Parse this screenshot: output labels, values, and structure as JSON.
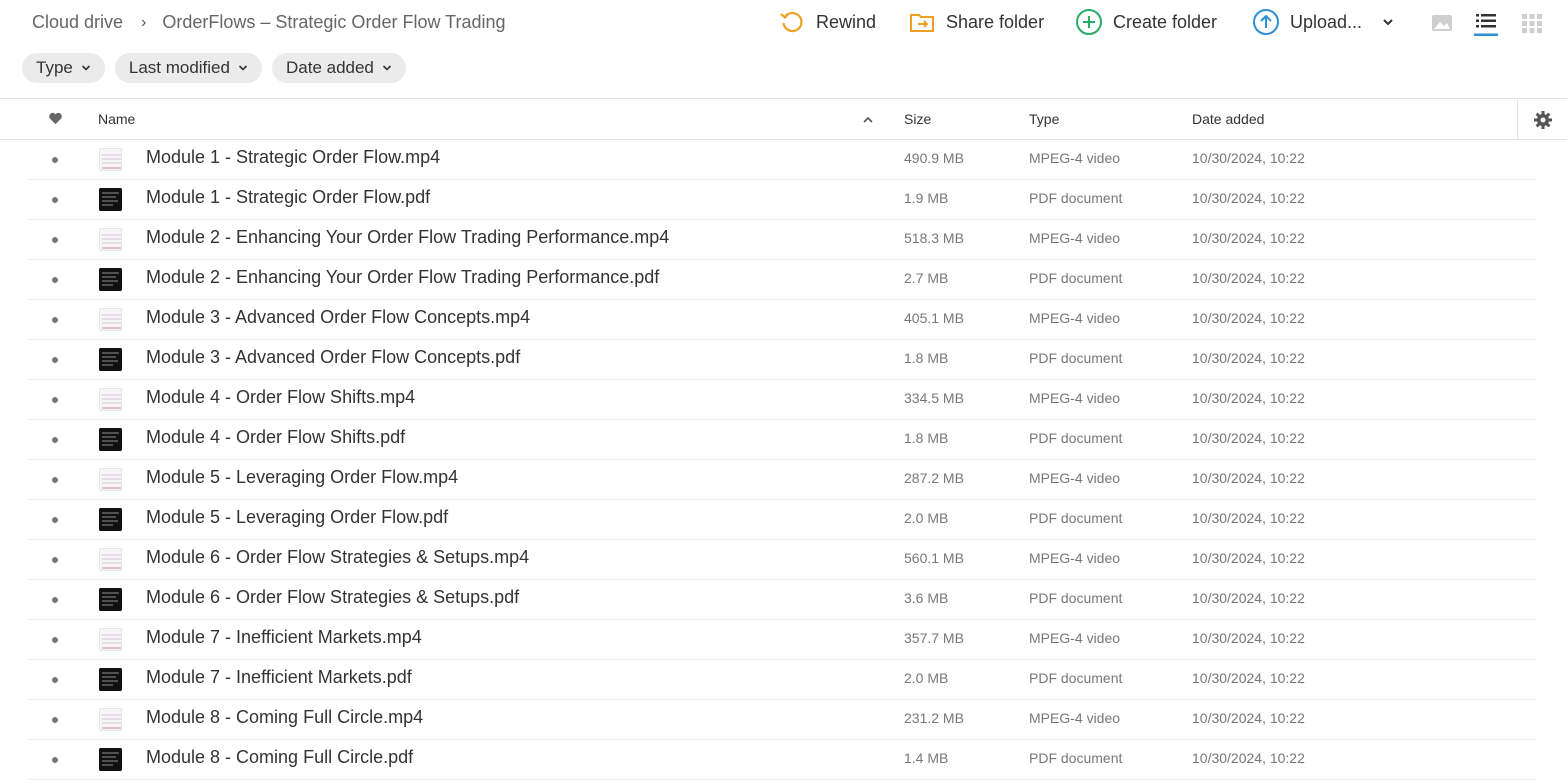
{
  "breadcrumb": {
    "root": "Cloud drive",
    "current": "OrderFlows – Strategic Order Flow Trading"
  },
  "toolbar": {
    "rewind": "Rewind",
    "share": "Share folder",
    "create": "Create folder",
    "upload": "Upload..."
  },
  "filters": [
    "Type",
    "Last modified",
    "Date added"
  ],
  "columns": {
    "name": "Name",
    "size": "Size",
    "type": "Type",
    "date": "Date added"
  },
  "colors": {
    "rewind": "#f0a020",
    "share": "#f0a020",
    "create": "#2aaa6a",
    "upload": "#2c8fd6",
    "active_view": "#2c8fd6"
  },
  "files": [
    {
      "name": "Module 1 - Strategic Order Flow.mp4",
      "size": "490.9 MB",
      "type": "MPEG-4 video",
      "date": "10/30/2024, 10:22",
      "kind": "video"
    },
    {
      "name": "Module 1 - Strategic Order Flow.pdf",
      "size": "1.9 MB",
      "type": "PDF document",
      "date": "10/30/2024, 10:22",
      "kind": "pdf"
    },
    {
      "name": "Module 2 - Enhancing Your Order Flow Trading Performance.mp4",
      "size": "518.3 MB",
      "type": "MPEG-4 video",
      "date": "10/30/2024, 10:22",
      "kind": "video"
    },
    {
      "name": "Module 2 - Enhancing Your Order Flow Trading Performance.pdf",
      "size": "2.7 MB",
      "type": "PDF document",
      "date": "10/30/2024, 10:22",
      "kind": "pdf"
    },
    {
      "name": "Module 3 - Advanced Order Flow Concepts.mp4",
      "size": "405.1 MB",
      "type": "MPEG-4 video",
      "date": "10/30/2024, 10:22",
      "kind": "video"
    },
    {
      "name": "Module 3 - Advanced Order Flow Concepts.pdf",
      "size": "1.8 MB",
      "type": "PDF document",
      "date": "10/30/2024, 10:22",
      "kind": "pdf"
    },
    {
      "name": "Module 4 - Order Flow Shifts.mp4",
      "size": "334.5 MB",
      "type": "MPEG-4 video",
      "date": "10/30/2024, 10:22",
      "kind": "video"
    },
    {
      "name": "Module 4 - Order Flow Shifts.pdf",
      "size": "1.8 MB",
      "type": "PDF document",
      "date": "10/30/2024, 10:22",
      "kind": "pdf"
    },
    {
      "name": "Module 5 - Leveraging Order Flow.mp4",
      "size": "287.2 MB",
      "type": "MPEG-4 video",
      "date": "10/30/2024, 10:22",
      "kind": "video"
    },
    {
      "name": "Module 5 - Leveraging Order Flow.pdf",
      "size": "2.0 MB",
      "type": "PDF document",
      "date": "10/30/2024, 10:22",
      "kind": "pdf"
    },
    {
      "name": "Module 6 - Order Flow Strategies & Setups.mp4",
      "size": "560.1 MB",
      "type": "MPEG-4 video",
      "date": "10/30/2024, 10:22",
      "kind": "video"
    },
    {
      "name": "Module 6 - Order Flow Strategies & Setups.pdf",
      "size": "3.6 MB",
      "type": "PDF document",
      "date": "10/30/2024, 10:22",
      "kind": "pdf"
    },
    {
      "name": "Module 7 - Inefficient Markets.mp4",
      "size": "357.7 MB",
      "type": "MPEG-4 video",
      "date": "10/30/2024, 10:22",
      "kind": "video"
    },
    {
      "name": "Module 7 - Inefficient Markets.pdf",
      "size": "2.0 MB",
      "type": "PDF document",
      "date": "10/30/2024, 10:22",
      "kind": "pdf"
    },
    {
      "name": "Module 8 - Coming Full Circle.mp4",
      "size": "231.2 MB",
      "type": "MPEG-4 video",
      "date": "10/30/2024, 10:22",
      "kind": "video"
    },
    {
      "name": "Module 8 - Coming Full Circle.pdf",
      "size": "1.4 MB",
      "type": "PDF document",
      "date": "10/30/2024, 10:22",
      "kind": "pdf"
    }
  ]
}
